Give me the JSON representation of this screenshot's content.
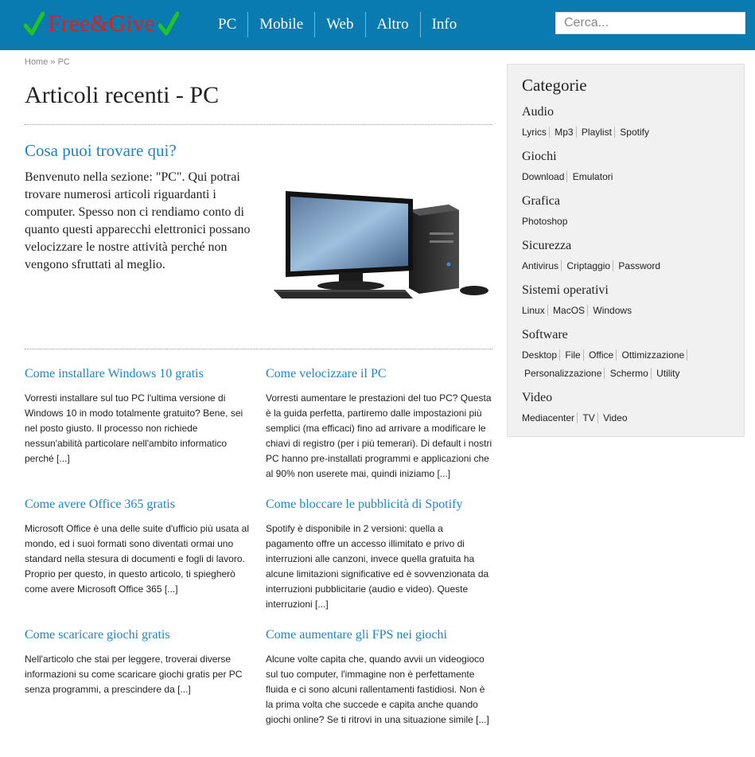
{
  "site": {
    "logo_text": "Free&Give"
  },
  "nav": [
    "PC",
    "Mobile",
    "Web",
    "Altro",
    "Info"
  ],
  "search": {
    "placeholder": "Cerca..."
  },
  "breadcrumb": {
    "home": "Home",
    "sep": "»",
    "current": "PC"
  },
  "page": {
    "title": "Articoli recenti - PC",
    "intro_title": "Cosa puoi trovare qui?",
    "intro_text": "Benvenuto nella sezione: \"PC\". Qui potrai trovare numerosi articoli riguardanti i computer. Spesso non ci rendiamo conto di quanto questi apparecchi elettronici possano velocizzare le nostre attività perché non vengono sfruttati al meglio."
  },
  "articles": [
    {
      "title": "Come installare Windows 10 gratis",
      "excerpt": "Vorresti installare sul tuo PC l'ultima versione di Windows 10 in modo totalmente gratuito? Bene, sei nel posto giusto. Il processo non richiede nessun'abilità particolare nell'ambito informatico perché [...]"
    },
    {
      "title": "Come velocizzare il PC",
      "excerpt": "Vorresti aumentare le prestazioni del tuo PC? Questa è la guida perfetta, partiremo dalle impostazioni più semplici (ma efficaci) fino ad arrivare a modificare le chiavi di registro (per i più temerari). Di default i nostri PC hanno pre-installati programmi e applicazioni che al 90% non userete mai, quindi iniziamo [...]"
    },
    {
      "title": "Come avere Office 365 gratis",
      "excerpt": "Microsoft Office è una delle suite d'ufficio più usata al mondo, ed i suoi formati sono diventati ormai uno standard nella stesura di documenti e fogli di lavoro. Proprio per questo, in questo articolo, ti spiegherò come avere Microsoft Office 365 [...]"
    },
    {
      "title": "Come bloccare le pubblicità di Spotify",
      "excerpt": "Spotify è disponibile in 2 versioni: quella a pagamento offre un accesso illimitato e privo di interruzioni alle canzoni, invece quella gratuita ha alcune limitazioni significative ed è sovvenzionata da interruzioni pubblicitarie (audio e video). Queste interruzioni [...]"
    },
    {
      "title": "Come scaricare giochi gratis",
      "excerpt": "Nell'articolo che stai per leggere, troverai diverse informazioni su come scaricare giochi gratis per PC senza programmi, a prescindere da [...]"
    },
    {
      "title": "Come aumentare gli FPS nei giochi",
      "excerpt": "Alcune volte capita che, quando avvii un videogioco sul tuo computer, l'immagine non è perfettamente fluida e ci sono alcuni rallentamenti fastidiosi. Non è la prima volta che succede e capita anche quando giochi online? Se ti ritrovi in una situazione simile [...]"
    }
  ],
  "sidebar": {
    "title": "Categorie",
    "categories": [
      {
        "name": "Audio",
        "links": [
          "Lyrics",
          "Mp3",
          "Playlist",
          "Spotify"
        ]
      },
      {
        "name": "Giochi",
        "links": [
          "Download",
          "Emulatori"
        ]
      },
      {
        "name": "Grafica",
        "links": [
          "Photoshop"
        ]
      },
      {
        "name": "Sicurezza",
        "links": [
          "Antivirus",
          "Criptaggio",
          "Password"
        ]
      },
      {
        "name": "Sistemi operativi",
        "links": [
          "Linux",
          "MacOS",
          "Windows"
        ]
      },
      {
        "name": "Software",
        "links": [
          "Desktop",
          "File",
          "Office",
          "Ottimizzazione",
          "Personalizzazione",
          "Schermo",
          "Utility"
        ]
      },
      {
        "name": "Video",
        "links": [
          "Mediacenter",
          "TV",
          "Video"
        ]
      }
    ]
  },
  "colors": {
    "header_bg": "#0a7bb0",
    "logo_red": "#e81b1b",
    "check_green": "#22c422",
    "link_blue": "#1b85c9",
    "sidebar_bg": "#f1f1f1"
  }
}
